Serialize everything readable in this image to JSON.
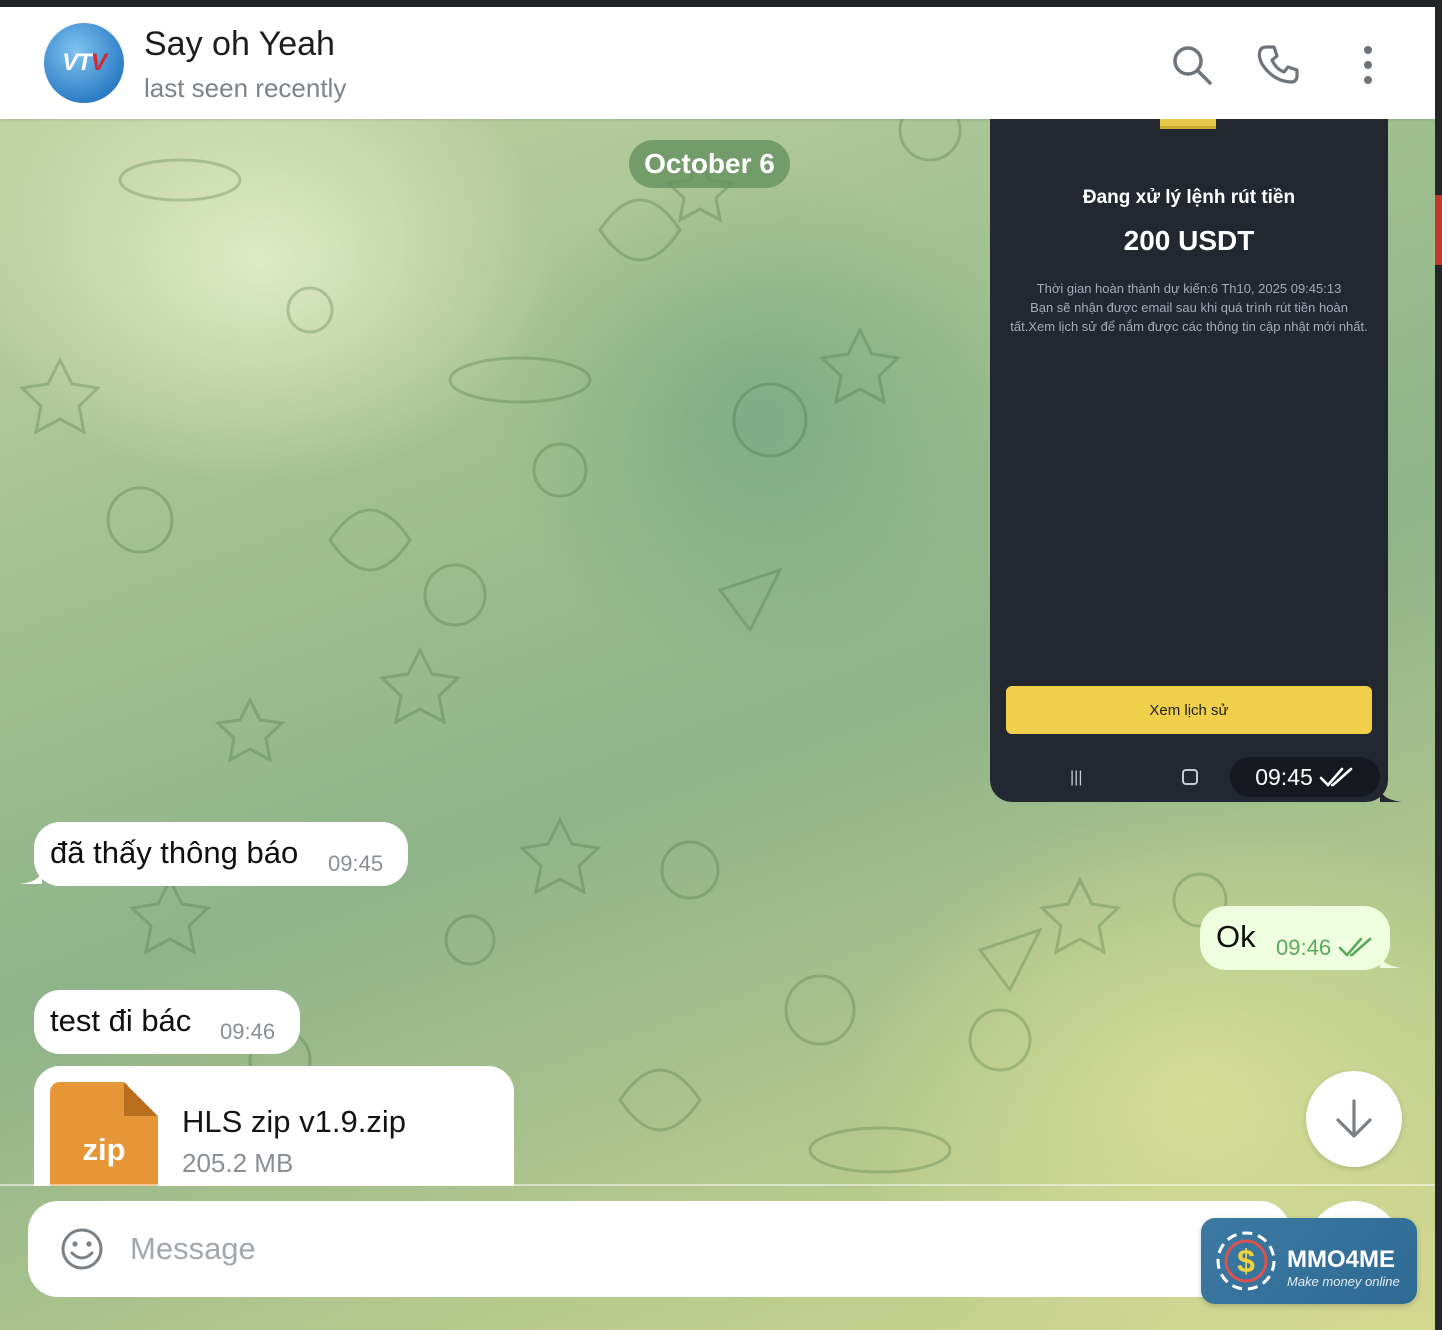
{
  "header": {
    "contact_name": "Say oh Yeah",
    "status": "last seen recently",
    "avatar_text_a": "VT",
    "avatar_text_b": "V",
    "icons": [
      "search-icon",
      "phone-icon",
      "more-vertical-icon"
    ]
  },
  "date_separator": "October 6",
  "messages": [
    {
      "type": "photo",
      "direction": "outgoing",
      "content": {
        "title": "Đang xử lý lệnh rút tiền",
        "amount": "200 USDT",
        "eta": "Thời gian hoàn thành dự kiến:6 Th10, 2025 09:45:13",
        "description": "Bạn sẽ nhận được email sau khi quá trình rút tiền hoàn tất.Xem lịch sử để nắm được các thông tin cập nhật mới nhất.",
        "button": "Xem lịch sử",
        "nav_recent": "|||"
      },
      "time": "09:45",
      "read": true
    },
    {
      "type": "text",
      "direction": "incoming",
      "text": "đã thấy thông báo",
      "time": "09:45"
    },
    {
      "type": "text",
      "direction": "outgoing",
      "text": "Ok",
      "time": "09:46",
      "read": true
    },
    {
      "type": "text",
      "direction": "incoming",
      "text": "test đi bác",
      "time": "09:46"
    },
    {
      "type": "file",
      "direction": "incoming",
      "extension": "zip",
      "file_name": "HLS zip v1.9.zip",
      "file_size": "205.2 MB"
    }
  ],
  "composer": {
    "placeholder": "Message",
    "value": ""
  },
  "watermark": {
    "brand": "MMO4ME",
    "slogan": "Make money online"
  },
  "colors": {
    "header_bg": "#ffffff",
    "incoming_bubble": "#ffffff",
    "outgoing_bubble": "#eefedf",
    "outgoing_time": "#5aa95e",
    "date_pill": "#6a9463",
    "photo_bg": "#232730",
    "photo_button": "#f0d04b",
    "file_icon": "#e79637"
  }
}
